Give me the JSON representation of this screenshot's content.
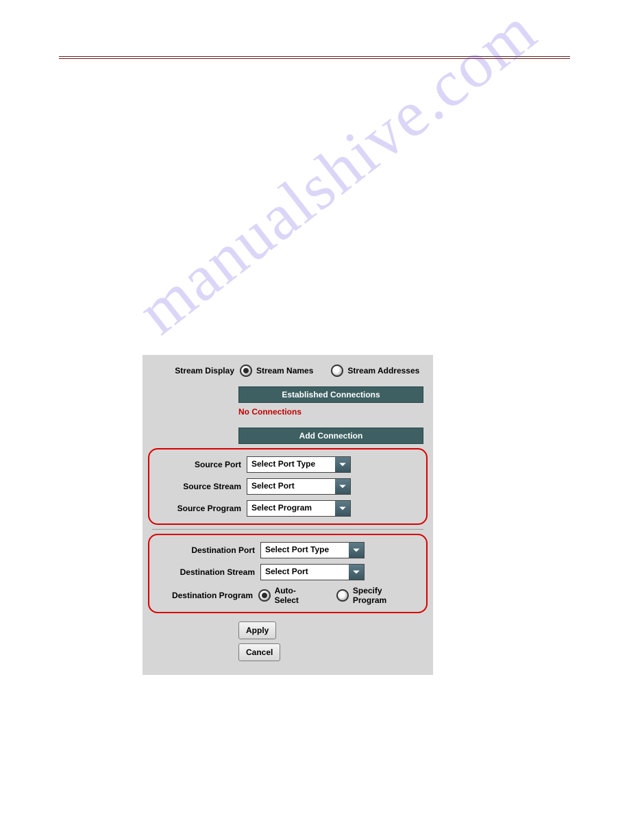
{
  "watermark": "manualshive.com",
  "panel": {
    "streamDisplay": {
      "label": "Stream Display",
      "options": [
        "Stream Names",
        "Stream Addresses"
      ],
      "selected": "Stream Names"
    },
    "establishedHeader": "Established Connections",
    "noConnections": "No Connections",
    "addHeader": "Add Connection",
    "source": {
      "port": {
        "label": "Source Port",
        "value": "Select Port Type"
      },
      "stream": {
        "label": "Source Stream",
        "value": "Select Port"
      },
      "program": {
        "label": "Source Program",
        "value": "Select Program"
      }
    },
    "destination": {
      "port": {
        "label": "Destination Port",
        "value": "Select Port Type"
      },
      "stream": {
        "label": "Destination Stream",
        "value": "Select Port"
      },
      "program": {
        "label": "Destination Program",
        "options": [
          "Auto-Select",
          "Specify Program"
        ],
        "selected": "Auto-Select"
      }
    },
    "buttons": {
      "apply": "Apply",
      "cancel": "Cancel"
    }
  }
}
